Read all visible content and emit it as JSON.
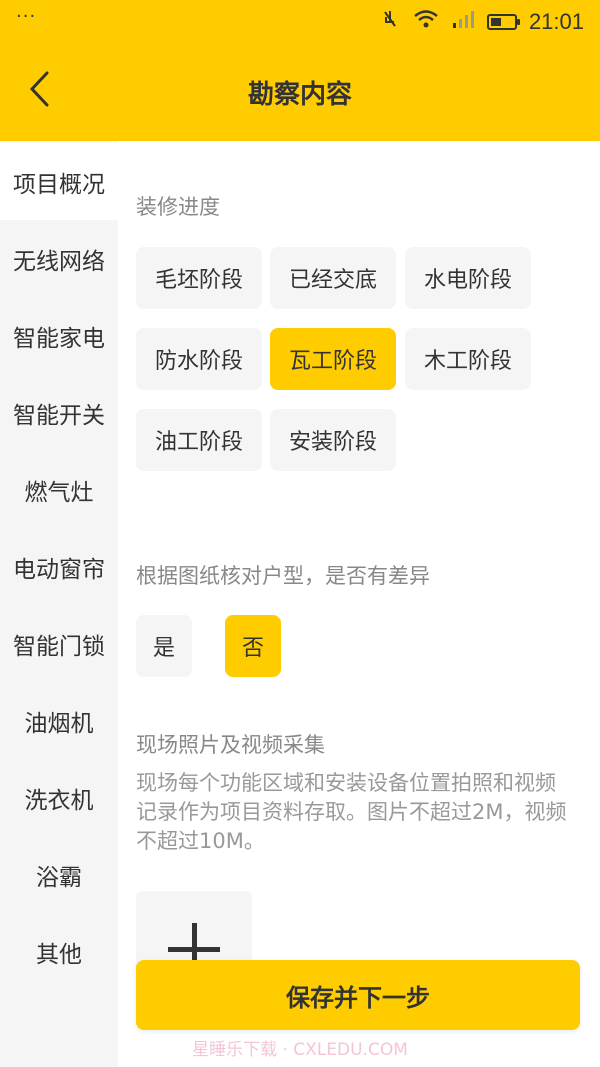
{
  "status_bar": {
    "time": "21:01",
    "dots": "···"
  },
  "header": {
    "title": "勘察内容",
    "back_icon": "chevron-left-icon"
  },
  "sidebar": {
    "items": [
      {
        "label": "项目概况",
        "active": true
      },
      {
        "label": "无线网络"
      },
      {
        "label": "智能家电"
      },
      {
        "label": "智能开关"
      },
      {
        "label": "燃气灶"
      },
      {
        "label": "电动窗帘"
      },
      {
        "label": "智能门锁"
      },
      {
        "label": "油烟机"
      },
      {
        "label": "洗衣机"
      },
      {
        "label": "浴霸"
      },
      {
        "label": "其他"
      }
    ]
  },
  "progress": {
    "label": "装修进度",
    "options": [
      "毛坯阶段",
      "已经交底",
      "水电阶段",
      "防水阶段",
      "瓦工阶段",
      "木工阶段",
      "油工阶段",
      "安装阶段"
    ],
    "selected": "瓦工阶段"
  },
  "layout_check": {
    "label": "根据图纸核对户型，是否有差异",
    "options": [
      "是",
      "否"
    ],
    "selected": "否"
  },
  "media": {
    "label": "现场照片及视频采集",
    "description": "现场每个功能区域和安装设备位置拍照和视频记录作为项目资料存取。图片不超过2M，视频不超过10M。"
  },
  "footer": {
    "save_label": "保存并下一步",
    "watermark": "星睡乐下载 · CXLEDU.COM"
  },
  "colors": {
    "accent": "#FFCC00",
    "sidebar_bg": "#F5F5F5"
  }
}
